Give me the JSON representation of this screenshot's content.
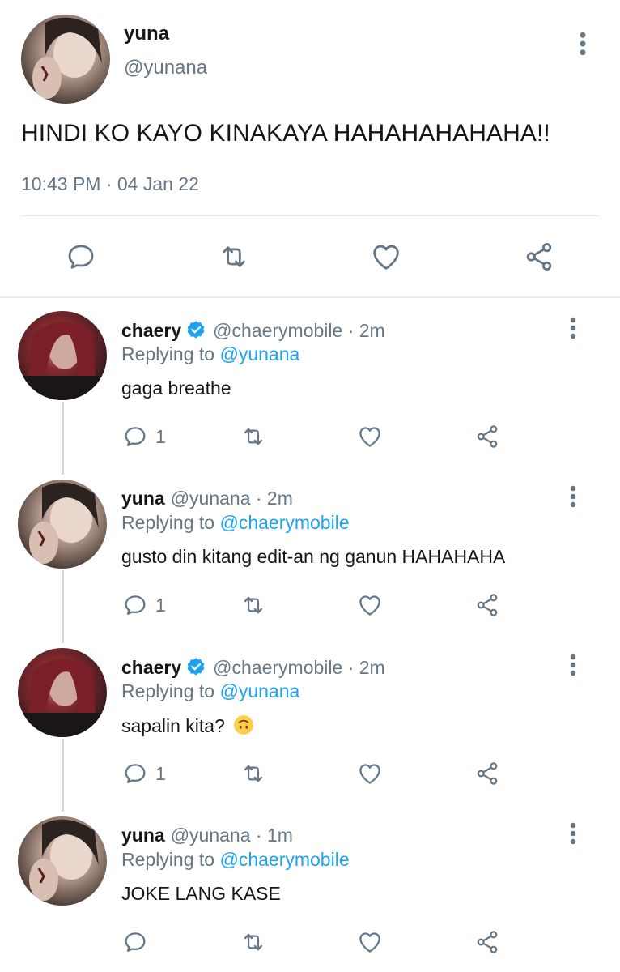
{
  "main_tweet": {
    "name": "yuna",
    "handle": "@yunana",
    "text": "HINDI KO KAYO KINAKAYA HAHAHAHAHAHA!!",
    "timestamp": "10:43 PM · 04 Jan 22",
    "actions": [
      "reply-icon",
      "retweet-icon",
      "like-icon",
      "share-icon"
    ]
  },
  "replies": [
    {
      "name": "chaery",
      "verified": true,
      "handle": "@chaerymobile · 2m",
      "replying_prefix": "Replying to",
      "replying_to": "@yunana",
      "text": "gaga breathe",
      "reply_count": "1"
    },
    {
      "name": "yuna",
      "verified": false,
      "handle": "@yunana · 2m",
      "replying_prefix": "Replying to",
      "replying_to": "@chaerymobile",
      "text": "gusto din kitang edit-an ng ganun HAHAHAHA",
      "reply_count": "1"
    },
    {
      "name": "chaery",
      "verified": true,
      "handle": "@chaerymobile · 2m",
      "replying_prefix": "Replying to",
      "replying_to": "@yunana",
      "text": "sapalin kita?",
      "emoji": "upside-down-face",
      "reply_count": "1"
    },
    {
      "name": "yuna",
      "verified": false,
      "handle": "@yunana · 1m",
      "replying_prefix": "Replying to",
      "replying_to": "@chaerymobile",
      "text": "JOKE LANG KASE",
      "reply_count": ""
    }
  ],
  "colors": {
    "link": "#1da1f2",
    "secondary_text": "#657786",
    "icon": "#657786",
    "verified": "#1da1f2"
  }
}
